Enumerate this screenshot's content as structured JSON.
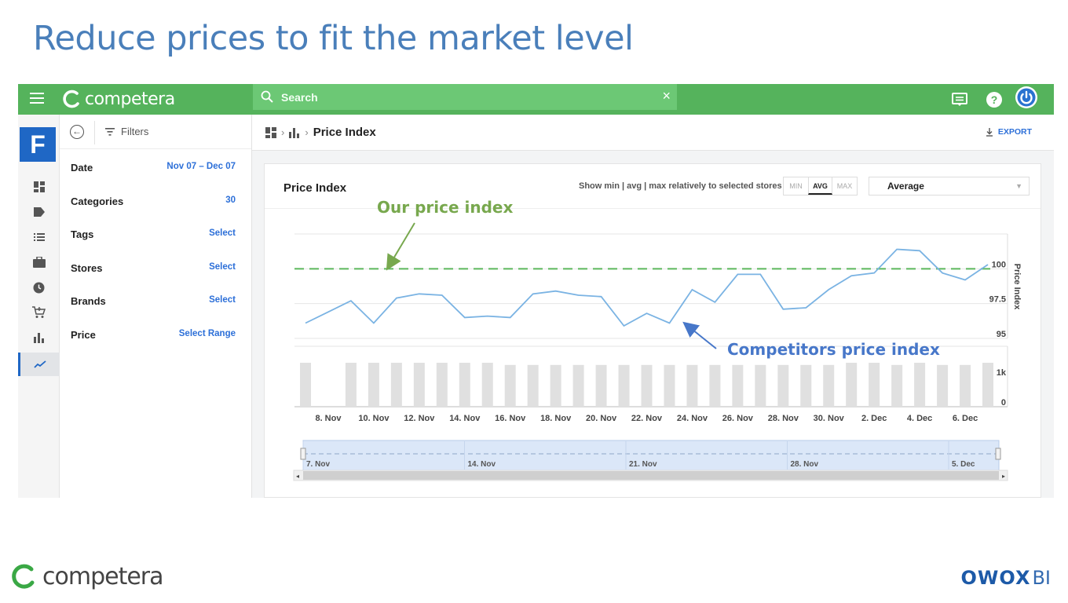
{
  "slide": {
    "title": "Reduce prices to fit the market level"
  },
  "app": {
    "brand": "competera",
    "search": {
      "placeholder": "Search"
    },
    "workspace_letter": "F"
  },
  "filters": {
    "header_label": "Filters",
    "rows": [
      {
        "label": "Date",
        "value": "Nov 07 – Dec 07"
      },
      {
        "label": "Categories",
        "value": "30"
      },
      {
        "label": "Tags",
        "value": "Select"
      },
      {
        "label": "Stores",
        "value": "Select"
      },
      {
        "label": "Brands",
        "value": "Select"
      },
      {
        "label": "Price",
        "value": "Select Range"
      }
    ]
  },
  "breadcrumb": {
    "title": "Price Index",
    "export_label": "EXPORT"
  },
  "card": {
    "title": "Price Index",
    "show_label": "Show min | avg | max relatively to selected stores",
    "modes": [
      "MIN",
      "AVG",
      "MAX"
    ],
    "active_mode": "AVG",
    "aggregate_select": "Average"
  },
  "annotations": {
    "ours": "Our price index",
    "competitors": "Competitors price index"
  },
  "chart_data": {
    "type": "line",
    "ylabel": "Price Index",
    "y_ticks": [
      "100",
      "97.5",
      "95"
    ],
    "ylim": [
      95,
      102.5
    ],
    "reference_line": {
      "value": 100,
      "color": "#5cb85c",
      "style": "dashed"
    },
    "x": [
      "7. Nov",
      "8. Nov",
      "9. Nov",
      "10. Nov",
      "11. Nov",
      "12. Nov",
      "13. Nov",
      "14. Nov",
      "15. Nov",
      "16. Nov",
      "17. Nov",
      "18. Nov",
      "19. Nov",
      "20. Nov",
      "21. Nov",
      "22. Nov",
      "23. Nov",
      "24. Nov",
      "25. Nov",
      "26. Nov",
      "27. Nov",
      "28. Nov",
      "29. Nov",
      "30. Nov",
      "1. Dec",
      "2. Dec",
      "3. Dec",
      "4. Dec",
      "5. Dec",
      "6. Dec",
      "7. Dec"
    ],
    "x_tick_labels": [
      "8. Nov",
      "10. Nov",
      "12. Nov",
      "14. Nov",
      "16. Nov",
      "18. Nov",
      "20. Nov",
      "22. Nov",
      "24. Nov",
      "26. Nov",
      "28. Nov",
      "30. Nov",
      "2. Dec",
      "4. Dec",
      "6. Dec"
    ],
    "series": [
      {
        "values": [
          96.1,
          96.9,
          97.7,
          96.1,
          97.9,
          98.2,
          98.1,
          96.5,
          96.6,
          96.5,
          98.2,
          98.4,
          98.1,
          98.0,
          95.9,
          96.8,
          96.1,
          98.5,
          97.6,
          99.6,
          99.6,
          97.1,
          97.2,
          98.5,
          99.5,
          99.7,
          101.4,
          101.3,
          99.7,
          99.2,
          100.3
        ],
        "color": "#7ab3e3"
      }
    ],
    "volume": {
      "y_ticks": [
        "1k",
        "0"
      ],
      "values": [
        1,
        0,
        1,
        1,
        1,
        1,
        1,
        1,
        1,
        0.95,
        0.95,
        0.95,
        0.95,
        0.95,
        0.95,
        0.95,
        0.95,
        0.95,
        0.95,
        0.95,
        0.95,
        0.95,
        0.95,
        0.95,
        1,
        1,
        0.95,
        1,
        0.95,
        0.95,
        1
      ],
      "color": "#e0e0e0"
    },
    "navigator_labels": [
      "7. Nov",
      "14. Nov",
      "21. Nov",
      "28. Nov",
      "5. Dec"
    ]
  },
  "footer": {
    "left_brand": "competera",
    "right_brand_strong": "OWOX",
    "right_brand_light": "BI"
  }
}
